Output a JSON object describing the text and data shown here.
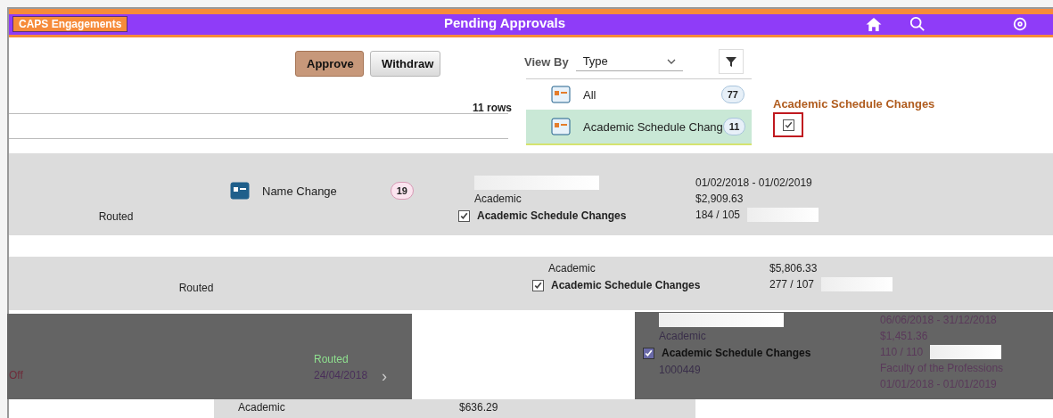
{
  "header": {
    "app": "CAPS Engagements",
    "title": "Pending Approvals"
  },
  "actions": [
    {
      "label": "Approve",
      "kind": "primary"
    },
    {
      "label": "Withdraw",
      "kind": "secondary"
    }
  ],
  "row_count": "11 rows",
  "view_by": {
    "label": "View By",
    "value": "Type"
  },
  "types": [
    {
      "label": "All",
      "count": "77",
      "selected": false
    },
    {
      "label": "Academic Schedule Chang",
      "count": "11",
      "selected": true
    },
    {
      "label": "Name Change",
      "count": "19",
      "selected": false
    }
  ],
  "detail": {
    "heading": "Academic Schedule Changes",
    "select_all_checked": true
  },
  "left_rows": [
    {
      "status": "Routed",
      "dimmed": false
    },
    {
      "status": "Routed",
      "dimmed": false
    },
    {
      "status": "Routed",
      "date": "24/04/2018",
      "note": "Off",
      "chevron": "›",
      "dimmed": true
    }
  ],
  "cards": [
    {
      "dimmed": false,
      "period": "01/02/2018 - 01/02/2019",
      "category": "Academic",
      "amount": "$2,909.63",
      "checked": true,
      "title": "Academic Schedule Changes",
      "ratio": "184 / 105"
    },
    {
      "dimmed": false,
      "category": "Academic",
      "amount": "$5,806.33",
      "checked": true,
      "title": "Academic Schedule Changes",
      "ratio": "277 / 107"
    },
    {
      "dimmed": true,
      "period": "06/06/2018 - 31/12/2018",
      "category": "Academic",
      "amount": "$1,451.36",
      "checked": true,
      "title": "Academic Schedule Changes",
      "ratio": "110 / 110",
      "id": "1000449",
      "faculty": "Faculty of the Professions",
      "period_2": "01/01/2018 - 01/01/2019"
    },
    {
      "dimmed": false,
      "category": "Academic",
      "amount": "$636.29"
    }
  ]
}
